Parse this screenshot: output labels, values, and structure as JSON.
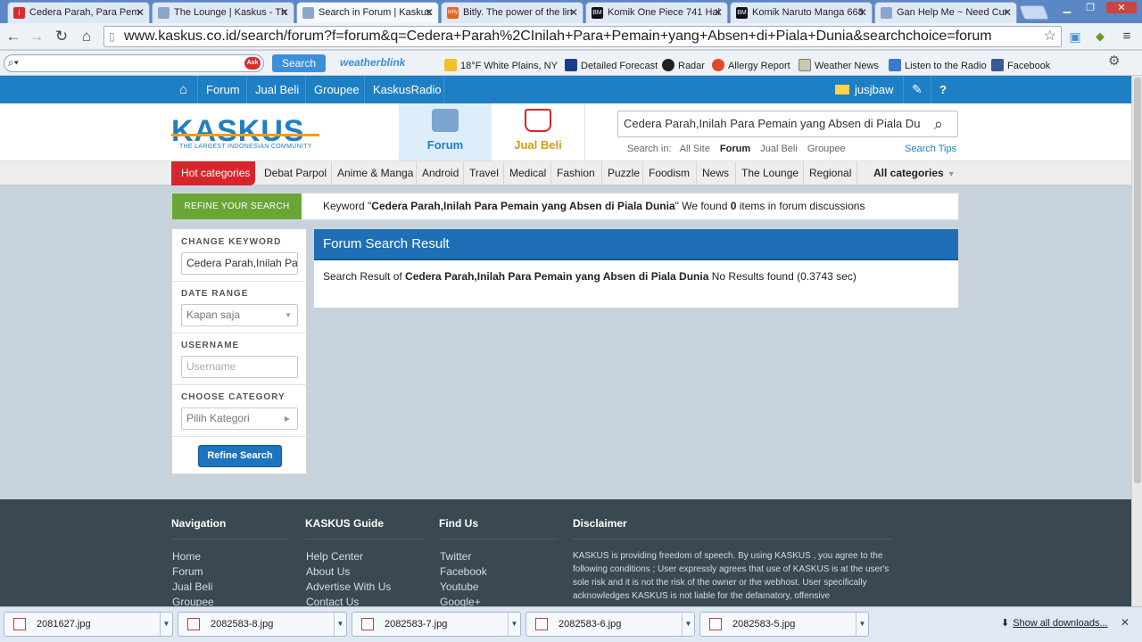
{
  "browser": {
    "tabs": [
      {
        "title": "Cedera Parah, Para Pem",
        "icon_color": "#d82b2b",
        "active": false
      },
      {
        "title": "The Lounge | Kaskus - Th",
        "icon_color": "#8aa6cc",
        "active": false
      },
      {
        "title": "Search in Forum | Kaskus",
        "icon_color": "#8aa6cc",
        "active": true
      },
      {
        "title": "Bitly. The power of the lin",
        "icon_color": "#ee6123",
        "active": false
      },
      {
        "title": "Komik One Piece 741 Hal",
        "icon_color": "#111111",
        "active": false
      },
      {
        "title": "Komik Naruto Manga 668",
        "icon_color": "#111111",
        "active": false
      },
      {
        "title": "Gan Help Me ~ Need Cur",
        "icon_color": "#8aa6cc",
        "active": false
      }
    ],
    "tab_icon_labels": [
      "i",
      "",
      "",
      "bitly",
      "BM",
      "BM",
      ""
    ],
    "url": "www.kaskus.co.id/search/forum?f=forum&q=Cedera+Parah%2CInilah+Para+Pemain+yang+Absen+di+Piala+Dunia&searchchoice=forum"
  },
  "toolbar": {
    "ask_logo": "Ask",
    "search_button": "Search",
    "weatherblink": "weatherblink",
    "bookmarks": [
      {
        "label": "18°F White Plains, NY",
        "icon": "sun-cloud-icon"
      },
      {
        "label": "Detailed Forecast",
        "icon": "twc-icon"
      },
      {
        "label": "Radar",
        "icon": "radar-icon"
      },
      {
        "label": "Allergy Report",
        "icon": "flower-icon"
      },
      {
        "label": "Weather News",
        "icon": "news-icon"
      },
      {
        "label": "Listen to the Radio",
        "icon": "play-icon"
      },
      {
        "label": "Facebook",
        "icon": "facebook-icon"
      }
    ]
  },
  "kaskus": {
    "topnav": [
      "Forum",
      "Jual Beli",
      "Groupee",
      "KaskusRadio"
    ],
    "username": "jusjbaw",
    "logo": "KASKUS",
    "logo_tagline": "THE LARGEST INDONESIAN COMMUNITY",
    "forum_tab": "Forum",
    "jualbeli_tab": "Jual Beli",
    "search_value": "Cedera Parah,Inilah Para Pemain yang Absen di Piala Dunia",
    "search_in_label": "Search in:",
    "search_in_options": [
      "All Site",
      "Forum",
      "Jual Beli",
      "Groupee"
    ],
    "search_tips": "Search Tips",
    "hot_categories": "Hot categories",
    "categories": [
      "Debat Parpol",
      "Anime & Manga",
      "Android",
      "Travel",
      "Medical",
      "Fashion",
      "Puzzle",
      "Foodism",
      "News",
      "The Lounge",
      "Regional"
    ],
    "all_categories": "All categories"
  },
  "refine": {
    "label": "REFINE YOUR SEARCH",
    "keyword_prefix": "Keyword \"",
    "keyword": "Cedera Parah,Inilah Para Pemain yang Absen di Piala Dunia",
    "keyword_mid": "\" We found ",
    "count": "0",
    "keyword_suffix": " items in forum discussions"
  },
  "sidebar": {
    "change_keyword_label": "CHANGE KEYWORD",
    "keyword_value": "Cedera Parah,Inilah Para Pemain yang Absen di Piala Dunia",
    "date_range_label": "DATE RANGE",
    "date_range_value": "Kapan saja",
    "username_label": "USERNAME",
    "username_placeholder": "Username",
    "category_label": "CHOOSE CATEGORY",
    "category_value": "Pilih Kategori",
    "refine_button": "Refine Search"
  },
  "result": {
    "title": "Forum Search Result",
    "prefix": "Search Result of ",
    "query": "Cedera Parah,Inilah Para Pemain yang Absen di Piala Dunia",
    "suffix": " No Results found (0.3743 sec)"
  },
  "footer": {
    "navigation_title": "Navigation",
    "navigation": [
      "Home",
      "Forum",
      "Jual Beli",
      "Groupee"
    ],
    "guide_title": "KASKUS Guide",
    "guide": [
      "Help Center",
      "About Us",
      "Advertise With Us",
      "Contact Us"
    ],
    "findus_title": "Find Us",
    "findus": [
      "Twitter",
      "Facebook",
      "Youtube",
      "Google+"
    ],
    "disclaimer_title": "Disclaimer",
    "disclaimer": "KASKUS is providing freedom of speech. By using KASKUS , you agree to the following conditions ; User expressly agrees that use of KASKUS is at the user's sole risk and it is not the risk of the owner or the webhost. User specifically acknowledges KASKUS is not liable for the defamatory, offensive"
  },
  "downloads": {
    "files": [
      "2081627.jpg",
      "2082583-8.jpg",
      "2082583-7.jpg",
      "2082583-6.jpg",
      "2082583-5.jpg"
    ],
    "show_all": "Show all downloads..."
  }
}
